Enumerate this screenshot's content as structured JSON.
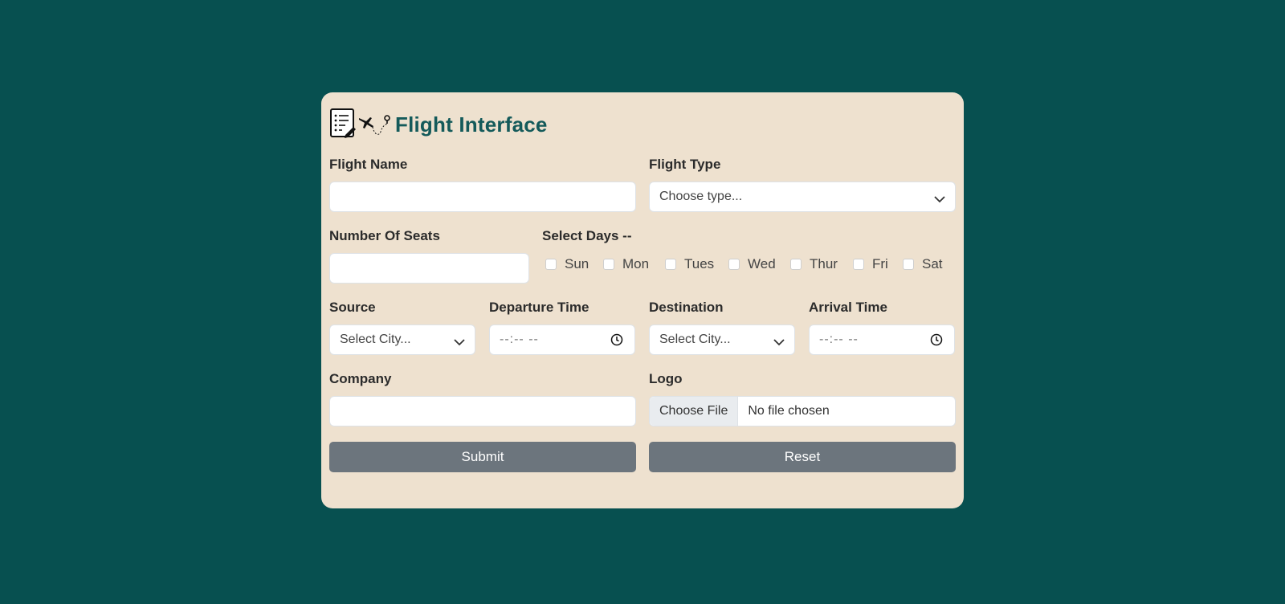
{
  "form": {
    "title": "Flight Interface",
    "flight_name": {
      "label": "Flight Name",
      "value": ""
    },
    "flight_type": {
      "label": "Flight Type",
      "value": "Choose type..."
    },
    "seats": {
      "label": "Number Of Seats",
      "value": ""
    },
    "days": {
      "label": "Select Days --",
      "items": [
        {
          "label": "Sun",
          "checked": false
        },
        {
          "label": "Mon",
          "checked": false
        },
        {
          "label": "Tues",
          "checked": false
        },
        {
          "label": "Wed",
          "checked": false
        },
        {
          "label": "Thur",
          "checked": false
        },
        {
          "label": "Fri",
          "checked": false
        },
        {
          "label": "Sat",
          "checked": false
        }
      ]
    },
    "source": {
      "label": "Source",
      "value": "Select City..."
    },
    "departure_time": {
      "label": "Departure Time",
      "value": "--:-- --"
    },
    "destination": {
      "label": "Destination",
      "value": "Select City..."
    },
    "arrival_time": {
      "label": "Arrival Time",
      "value": "--:-- --"
    },
    "company": {
      "label": "Company",
      "value": ""
    },
    "logo": {
      "label": "Logo",
      "button": "Choose File",
      "status": "No file chosen"
    },
    "submit_label": "Submit",
    "reset_label": "Reset"
  },
  "colors": {
    "background": "#075050",
    "card": "#eee1cf",
    "title": "#145a5a",
    "button": "#6c757d"
  },
  "icons": [
    "checklist-icon",
    "flight-path-icon",
    "chevron-down-icon",
    "clock-icon"
  ]
}
